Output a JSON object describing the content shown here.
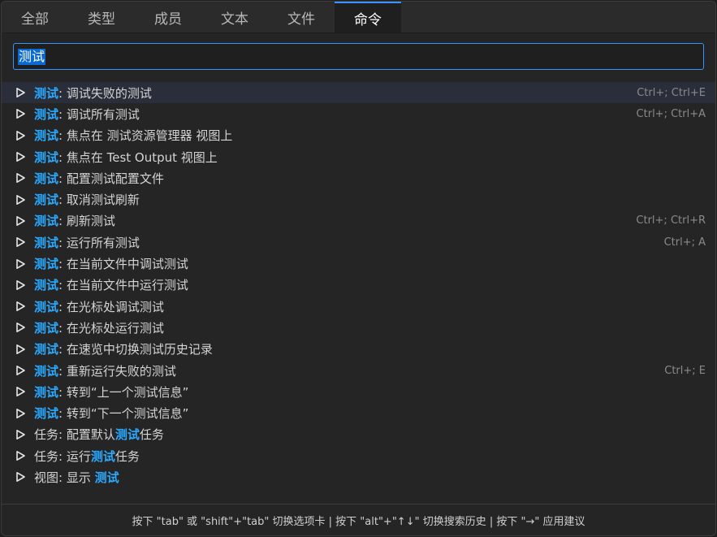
{
  "tabs": [
    {
      "label": "全部",
      "active": false
    },
    {
      "label": "类型",
      "active": false
    },
    {
      "label": "成员",
      "active": false
    },
    {
      "label": "文本",
      "active": false
    },
    {
      "label": "文件",
      "active": false
    },
    {
      "label": "命令",
      "active": true
    }
  ],
  "search": {
    "value": "测试"
  },
  "rows": [
    {
      "pre": "",
      "hl": "测试",
      "post": ": 调试失败的测试",
      "shortcut": "Ctrl+; Ctrl+E",
      "selected": true
    },
    {
      "pre": "",
      "hl": "测试",
      "post": ": 调试所有测试",
      "shortcut": "Ctrl+; Ctrl+A",
      "selected": false
    },
    {
      "pre": "",
      "hl": "测试",
      "post": ": 焦点在 测试资源管理器 视图上",
      "shortcut": "",
      "selected": false
    },
    {
      "pre": "",
      "hl": "测试",
      "post": ": 焦点在 Test Output 视图上",
      "shortcut": "",
      "selected": false
    },
    {
      "pre": "",
      "hl": "测试",
      "post": ": 配置测试配置文件",
      "shortcut": "",
      "selected": false
    },
    {
      "pre": "",
      "hl": "测试",
      "post": ": 取消测试刷新",
      "shortcut": "",
      "selected": false
    },
    {
      "pre": "",
      "hl": "测试",
      "post": ": 刷新测试",
      "shortcut": "Ctrl+; Ctrl+R",
      "selected": false
    },
    {
      "pre": "",
      "hl": "测试",
      "post": ": 运行所有测试",
      "shortcut": "Ctrl+; A",
      "selected": false
    },
    {
      "pre": "",
      "hl": "测试",
      "post": ": 在当前文件中调试测试",
      "shortcut": "",
      "selected": false
    },
    {
      "pre": "",
      "hl": "测试",
      "post": ": 在当前文件中运行测试",
      "shortcut": "",
      "selected": false
    },
    {
      "pre": "",
      "hl": "测试",
      "post": ": 在光标处调试测试",
      "shortcut": "",
      "selected": false
    },
    {
      "pre": "",
      "hl": "测试",
      "post": ": 在光标处运行测试",
      "shortcut": "",
      "selected": false
    },
    {
      "pre": "",
      "hl": "测试",
      "post": ": 在速览中切换测试历史记录",
      "shortcut": "",
      "selected": false
    },
    {
      "pre": "",
      "hl": "测试",
      "post": ": 重新运行失败的测试",
      "shortcut": "Ctrl+; E",
      "selected": false
    },
    {
      "pre": "",
      "hl": "测试",
      "post": ": 转到“上一个测试信息”",
      "shortcut": "",
      "selected": false
    },
    {
      "pre": "",
      "hl": "测试",
      "post": ": 转到“下一个测试信息”",
      "shortcut": "",
      "selected": false
    },
    {
      "pre": "任务: 配置默认",
      "hl": "测试",
      "post": "任务",
      "shortcut": "",
      "selected": false
    },
    {
      "pre": "任务: 运行",
      "hl": "测试",
      "post": "任务",
      "shortcut": "",
      "selected": false
    },
    {
      "pre": "视图: 显示 ",
      "hl": "测试",
      "post": "",
      "shortcut": "",
      "selected": false
    }
  ],
  "footer": {
    "hint": "按下 \"tab\" 或 \"shift\"+\"tab\" 切换选项卡 | 按下 \"alt\"+\"↑↓\" 切换搜索历史 | 按下 \"→\" 应用建议"
  },
  "colors": {
    "accent": "#3794ff",
    "highlight": "#2aaaff",
    "background": "#252526"
  },
  "icons": {
    "row": "play-icon"
  }
}
